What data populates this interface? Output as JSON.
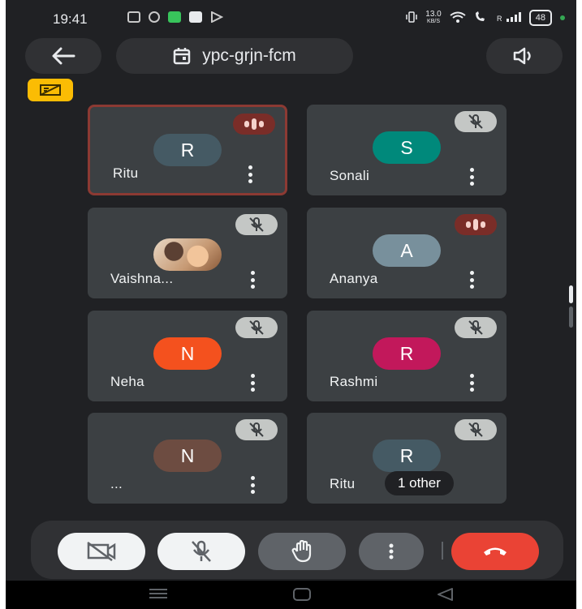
{
  "status_bar": {
    "time": "19:41",
    "speed": "13.0",
    "speed_unit": "KB/S",
    "battery": "48"
  },
  "header": {
    "meeting_code": "ypc-grjn-fcm",
    "icons": {
      "back": "arrow-left-icon",
      "calendar": "calendar-icon",
      "audio": "speaker-icon",
      "badge": "camera-off-badge-icon"
    }
  },
  "participants": [
    {
      "name": "Ritu",
      "initial": "R",
      "avatar_color": "#455a64",
      "status": "speaking"
    },
    {
      "name": "Sonali",
      "initial": "S",
      "avatar_color": "#00897b",
      "status": "muted"
    },
    {
      "name": "Vaishna...",
      "initial": "",
      "avatar_color": "",
      "status": "muted",
      "photo": true
    },
    {
      "name": "Ananya",
      "initial": "A",
      "avatar_color": "#78909c",
      "status": "speaking"
    },
    {
      "name": "Neha",
      "initial": "N",
      "avatar_color": "#f4511e",
      "status": "muted"
    },
    {
      "name": "Rashmi",
      "initial": "R",
      "avatar_color": "#c2185b",
      "status": "muted"
    },
    {
      "name": "...",
      "initial": "N",
      "avatar_color": "#6d4c41",
      "status": "muted"
    },
    {
      "name": "Ritu",
      "initial": "R",
      "avatar_color": "#455a64",
      "status": "muted",
      "others_label": "1 other"
    }
  ],
  "controls": {
    "camera": "camera-off-icon",
    "mic": "mic-off-icon",
    "raise_hand": "hand-icon",
    "more": "more-vert-icon",
    "end_call": "phone-hangup-icon"
  },
  "colors": {
    "accent_red": "#ea4335",
    "badge_yellow": "#fbbc04",
    "speaking_border": "#8c3a33"
  }
}
